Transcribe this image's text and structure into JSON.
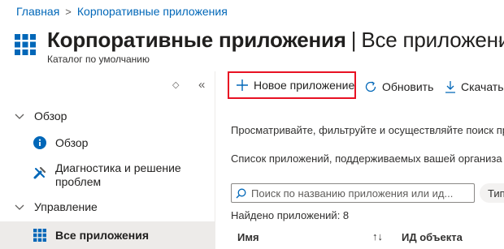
{
  "breadcrumb": {
    "home": "Главная",
    "separator": ">",
    "current": "Корпоративные приложения"
  },
  "header": {
    "title": "Корпоративные приложения",
    "separator": "|",
    "subtitle_main": "Все приложения",
    "directory": "Каталог по умолчанию",
    "more": "..."
  },
  "sidebar": {
    "sort_icon": "◇",
    "collapse_icon": "«",
    "items": [
      {
        "label": "Обзор",
        "type": "group"
      },
      {
        "label": "Обзор",
        "type": "child",
        "icon": "info-icon"
      },
      {
        "label": "Диагностика и решение проблем",
        "line1": "Диагностика и решение",
        "line2": "проблем",
        "type": "child",
        "icon": "wrench-icon"
      },
      {
        "label": "Управление",
        "type": "group"
      },
      {
        "label": "Все приложения",
        "type": "child",
        "icon": "grid-icon",
        "selected": true
      }
    ]
  },
  "toolbar": {
    "new_app": "Новое приложение",
    "refresh": "Обновить",
    "download": "Скачать"
  },
  "main": {
    "description": "Просматривайте, фильтруйте и осуществляйте поиск при",
    "list_info": "Список приложений, поддерживаемых вашей организа",
    "search_placeholder": "Поиск по названию приложения или ид...",
    "filter_pill": "Тип",
    "found": "Найдено приложений: 8",
    "columns": [
      "Имя",
      "ИД объекта"
    ]
  },
  "colors": {
    "accent": "#0067b8",
    "highlight_border": "#e81123",
    "selected_bg": "#edebe9"
  }
}
